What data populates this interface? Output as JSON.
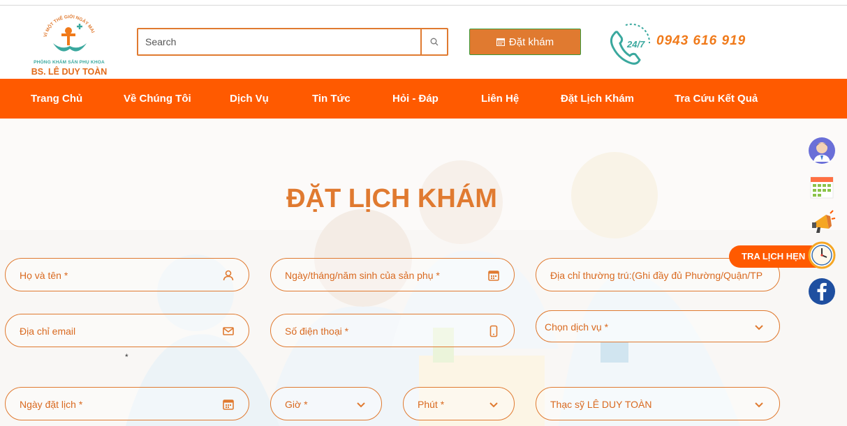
{
  "header": {
    "logo_tagline": "VÌ MỘT THẾ GIỚI NGÀY MAI",
    "logo_subtitle": "PHÒNG KHÁM SẢN PHỤ KHOA",
    "logo_name": "BS. LÊ DUY TOÀN",
    "search_placeholder": "Search",
    "search_icon": "search-icon",
    "book_button_label": "Đặt khám",
    "book_button_icon": "calendar-icon",
    "hotline_badge": "24/7",
    "hotline_number": "0943 616 919"
  },
  "nav": {
    "items": [
      {
        "label": "Trang Chủ"
      },
      {
        "label": "Về Chúng Tôi"
      },
      {
        "label": "Dịch Vụ"
      },
      {
        "label": "Tin Tức"
      },
      {
        "label": "Hỏi - Đáp"
      },
      {
        "label": "Liên Hệ"
      },
      {
        "label": "Đặt Lịch Khám"
      },
      {
        "label": "Tra Cứu Kết Quả"
      }
    ]
  },
  "form": {
    "title": "ĐẶT LỊCH KHÁM",
    "fields": {
      "full_name": "Họ và tên *",
      "dob": "Ngày/tháng/năm sinh của sản phụ *",
      "address": "Địa chỉ thường trú:(Ghi đầy đủ Phường/Quận/TP",
      "email": "Địa chỉ email",
      "phone": "Số điện thoại *",
      "service": "Chọn dịch vụ *",
      "booking_date": "Ngày đặt lịch *",
      "hour": "Giờ *",
      "minute": "Phút *",
      "doctor": "Thạc sỹ LÊ DUY TOÀN"
    },
    "stray_mark": "*"
  },
  "side_widgets": {
    "appointment_lookup_label": "TRA LỊCH HẸN",
    "icons": [
      "doctor-avatar-icon",
      "calendar-grid-icon",
      "megaphone-icon",
      "clock-icon",
      "facebook-icon"
    ]
  },
  "colors": {
    "brand_orange": "#ff5a00",
    "accent_orange": "#e07a30",
    "teal": "#3aa89e",
    "facebook_blue": "#1877f2"
  }
}
